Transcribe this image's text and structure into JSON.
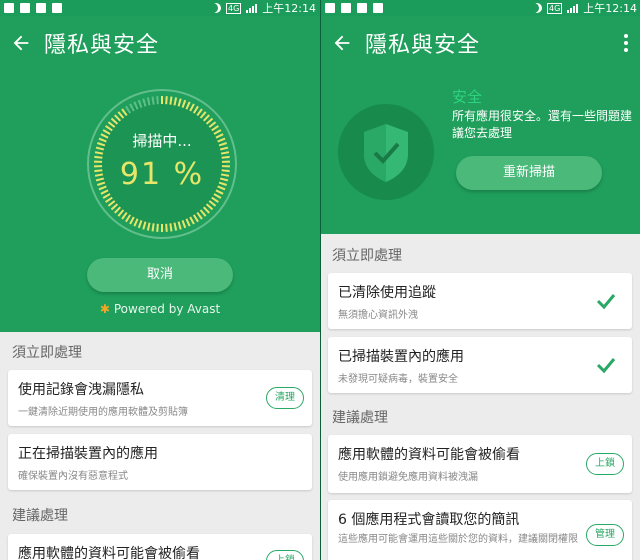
{
  "status": {
    "time": "上午12:14",
    "network": "4G"
  },
  "left": {
    "title": "隱私與安全",
    "scan_label": "掃描中...",
    "scan_percent": "91 %",
    "scan_progress": 0.91,
    "cancel_label": "取消",
    "powered_by": "Powered by Avast",
    "sections": [
      {
        "header": "須立即處理"
      },
      {
        "header": "建議處理"
      }
    ],
    "cards": [
      {
        "title": "使用記錄會洩漏隱私",
        "subtitle": "一鍵清除近期使用的應用軟體及剪貼簿",
        "action": "清理"
      },
      {
        "title": "正在掃描裝置內的應用",
        "subtitle": "確保裝置內沒有惡意程式"
      },
      {
        "title": "應用軟體的資料可能會被偷看",
        "action": "上鎖"
      }
    ]
  },
  "right": {
    "title": "隱私與安全",
    "safe_title": "安全",
    "safe_desc": "所有應用很安全。還有一些問題建議您去處理",
    "rescan_label": "重新掃描",
    "sections": [
      {
        "header": "須立即處理"
      },
      {
        "header": "建議處理"
      }
    ],
    "cards": [
      {
        "title": "已清除使用追蹤",
        "subtitle": "無須擔心資訊外洩"
      },
      {
        "title": "已掃描裝置內的應用",
        "subtitle": "未發現可疑病毒，裝置安全"
      },
      {
        "title": "應用軟體的資料可能會被偷看",
        "subtitle": "使用應用鎖避免應用資料被洩漏",
        "action": "上鎖"
      },
      {
        "title": "6 個應用程式會讀取您的簡訊",
        "subtitle": "這些應用可能會運用這些關於您的資料，建議關閉權限",
        "action": "管理"
      }
    ]
  },
  "colors": {
    "primary": "#1f9f5b",
    "accent": "#2aa866",
    "progress": "#e6e66a",
    "safe": "#2ed37f"
  }
}
